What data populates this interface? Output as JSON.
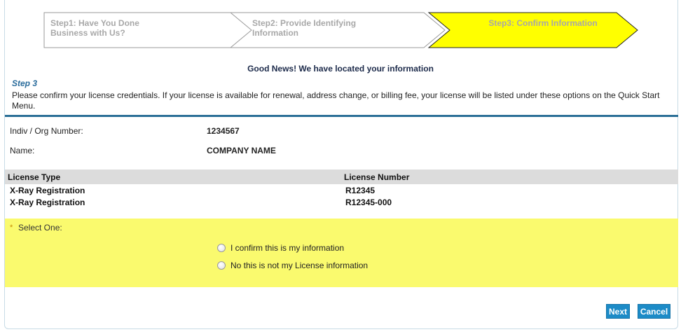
{
  "steps": [
    {
      "label_line1": "Step1: Have You Done",
      "label_line2": "Business with Us?"
    },
    {
      "label_line1": "Step2: Provide Identifying",
      "label_line2": "Information"
    },
    {
      "label_line1": "Step3: Confirm Information",
      "label_line2": ""
    }
  ],
  "active_step_color": "#ffff00",
  "good_news": "Good News! We have located your information",
  "step_title": "Step 3",
  "step_description": "Please confirm your license credentials. If your license is available for renewal, address change, or billing fee, your license will be listed under these options on the Quick Start Menu.",
  "info": {
    "org_number_label": "Indiv / Org Number:",
    "org_number_value": "1234567",
    "name_label": "Name:",
    "name_value": "COMPANY NAME"
  },
  "license_table": {
    "headers": [
      "License Type",
      "License Number"
    ],
    "rows": [
      [
        "X-Ray Registration",
        "R12345"
      ],
      [
        "X-Ray Registration",
        "R12345-000"
      ]
    ]
  },
  "select": {
    "required_mark": "*",
    "label": "Select One:",
    "options": [
      "I confirm this is my information",
      "No this is not my License information"
    ]
  },
  "buttons": {
    "next": "Next",
    "cancel": "Cancel"
  }
}
